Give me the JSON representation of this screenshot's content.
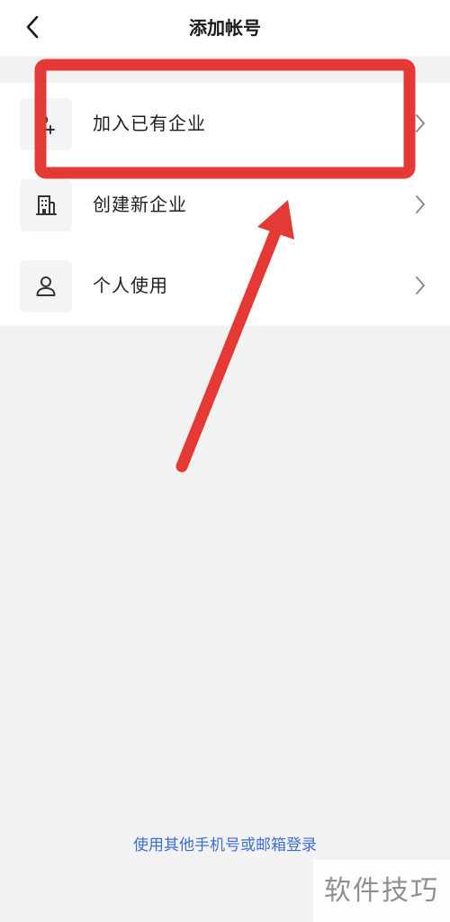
{
  "header": {
    "title": "添加帐号",
    "back_icon": "chevron-left-icon"
  },
  "menu": {
    "items": [
      {
        "label": "加入已有企业",
        "icon": "person-add-icon",
        "highlighted": true
      },
      {
        "label": "创建新企业",
        "icon": "building-icon",
        "highlighted": false
      },
      {
        "label": "个人使用",
        "icon": "person-icon",
        "highlighted": false
      }
    ]
  },
  "footer": {
    "alt_login_link": "使用其他手机号或邮箱登录"
  },
  "watermark": {
    "text": "软件技巧"
  },
  "colors": {
    "background": "#f2f2f3",
    "panel": "#ffffff",
    "link": "#3d6fd0",
    "annotation_red": "#e53935",
    "chevron": "#8a8a8a"
  }
}
